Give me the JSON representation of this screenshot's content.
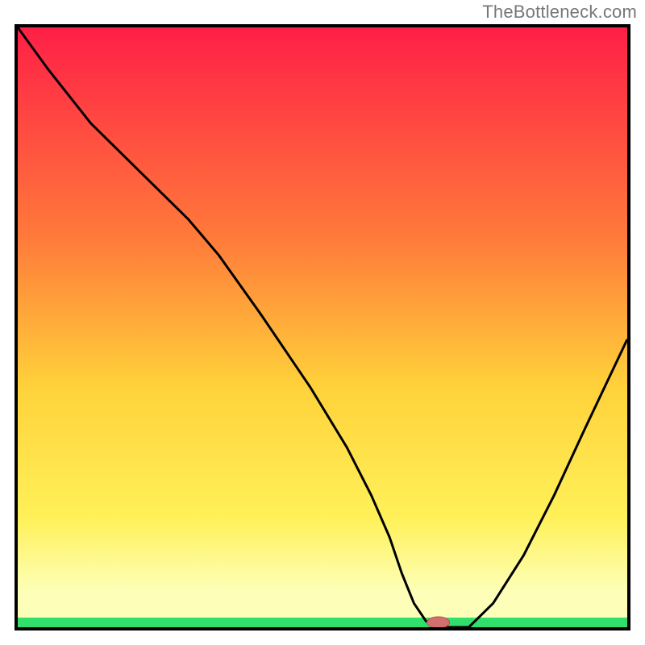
{
  "watermark": "TheBottleneck.com",
  "colors": {
    "grad_top": "#ff1f47",
    "grad_mid_upper": "#ff7a3a",
    "grad_mid": "#ffd23a",
    "grad_mid_lower": "#fff15a",
    "grad_low": "#fdffb8",
    "green": "#30e06b",
    "curve": "#000000",
    "marker_fill": "#d36f6f",
    "marker_stroke": "#b74f4f"
  },
  "chart_data": {
    "type": "line",
    "title": "",
    "xlabel": "",
    "ylabel": "",
    "xlim": [
      0,
      100
    ],
    "ylim": [
      0,
      100
    ],
    "x": [
      0,
      5,
      12,
      20,
      28,
      33,
      40,
      48,
      54,
      58,
      61,
      63,
      65,
      67,
      70,
      74,
      78,
      83,
      88,
      93,
      100
    ],
    "values": [
      100,
      93,
      84,
      76,
      68,
      62,
      52,
      40,
      30,
      22,
      15,
      9,
      4,
      1,
      0,
      0,
      4,
      12,
      22,
      33,
      48
    ],
    "marker": {
      "x": 69,
      "y": 0
    },
    "notes": "V-shaped bottleneck curve over rainbow vertical gradient; minimum / green zone around x≈65–74."
  }
}
